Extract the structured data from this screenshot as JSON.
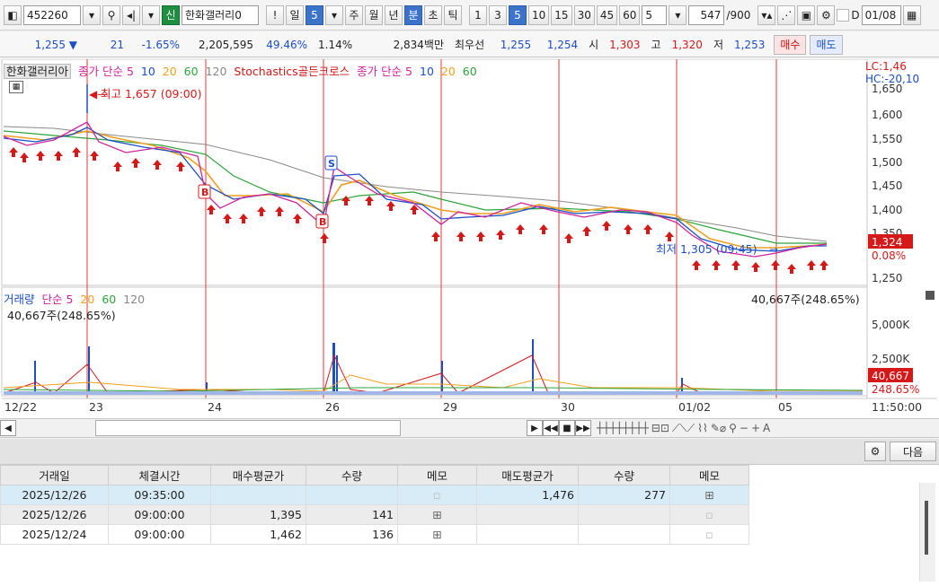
{
  "toolbar": {
    "code": "452260",
    "badge": "신",
    "name": "한화갤러리0",
    "excl": "!",
    "period_label": "일",
    "period_num": "5",
    "periods": [
      "주",
      "월",
      "년",
      "분",
      "초",
      "틱"
    ],
    "intervals": [
      "1",
      "3",
      "5",
      "10",
      "15",
      "30",
      "45",
      "60"
    ],
    "interval_selected": "5",
    "count_select": "5",
    "bar_count": "547",
    "bar_total": "/900",
    "check_label": "D",
    "date": "01/08"
  },
  "quote": {
    "price": "1,255",
    "change": "21",
    "change_pct": "-1.65%",
    "volume": "2,205,595",
    "vol_ratio": "49.46%",
    "turnover": "1.14%",
    "amount": "2,834백만",
    "best_label": "최우선",
    "best_ask": "1,255",
    "best_bid": "1,254",
    "open_label": "시",
    "open": "1,303",
    "high_label": "고",
    "high": "1,320",
    "low_label": "저",
    "low": "1,253",
    "buy": "매수",
    "sell": "매도"
  },
  "chart": {
    "legend_name": "한화갤러리아",
    "legend_ma_label": "종가 단순 5",
    "legend_ma": [
      "10",
      "20",
      "60",
      "120"
    ],
    "legend_stoch": "Stochastics골든크로스",
    "legend_ma2_label": "종가 단순 5",
    "legend_ma2": [
      "10",
      "20",
      "60"
    ],
    "lc": "LC:1,46",
    "hc": "HC:-20,10",
    "high_note": "최고 1,657 (09:00)",
    "low_note": "최저 1,305 (09:45)",
    "price_ticks": [
      "1,650",
      "1,600",
      "1,550",
      "1,500",
      "1,450",
      "1,400",
      "1,350",
      "1,250"
    ],
    "cur_price": "1,324",
    "cur_pct": "0.08%",
    "vol_legend_label": "거래량",
    "vol_legend_ma_label": "단순 5",
    "vol_legend_ma": [
      "20",
      "60",
      "120"
    ],
    "vol_value": "40,667주(248.65%)",
    "vol_value_right": "40,667주(248.65%)",
    "vol_ticks": [
      "5,000K",
      "2,500K"
    ],
    "vol_cur": "40,667",
    "vol_cur_pct": "248.65%",
    "dates": [
      "12/22",
      "23",
      "24",
      "26",
      "29",
      "30",
      "01/02",
      "05"
    ],
    "time_label": "11:50:00",
    "signal_s": "S",
    "signal_b": "B"
  },
  "scroll": {
    "tools_hint": "chart-drawing-tools"
  },
  "actions": {
    "next": "다음"
  },
  "table": {
    "headers": [
      "거래일",
      "체결시간",
      "매수평균가",
      "수량",
      "메모",
      "매도평균가",
      "수량",
      "메모"
    ],
    "rows": [
      [
        "2025/12/26",
        "09:35:00",
        "",
        "",
        "memo",
        "1,476",
        "277",
        "memo"
      ],
      [
        "2025/12/26",
        "09:00:00",
        "1,395",
        "141",
        "memo",
        "",
        "",
        "memo"
      ],
      [
        "2025/12/24",
        "09:00:00",
        "1,462",
        "136",
        "memo",
        "",
        "",
        "memo"
      ]
    ]
  }
}
